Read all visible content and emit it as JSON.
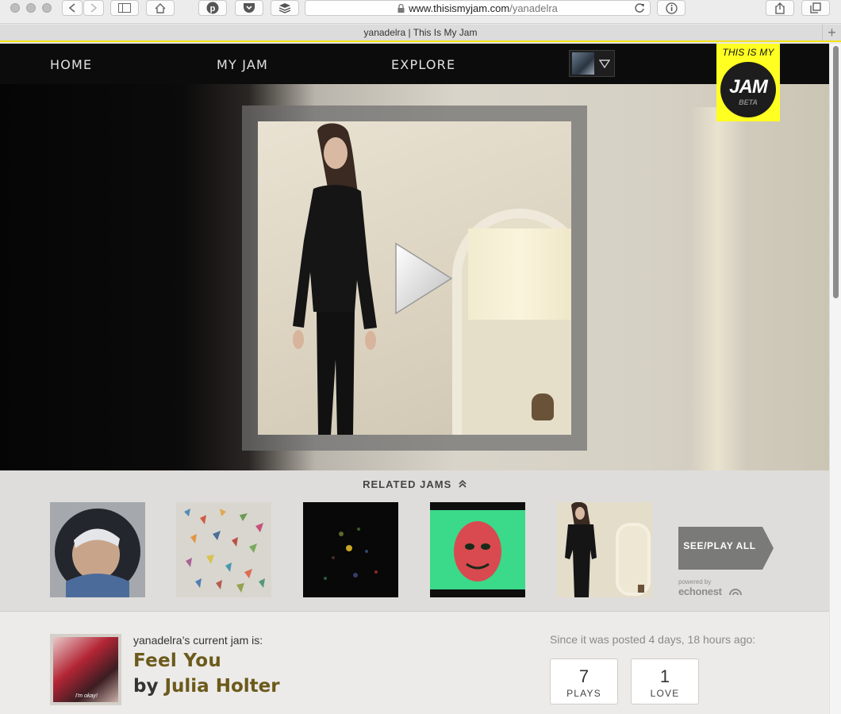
{
  "browser": {
    "url_host": "www.thisismyjam.com",
    "url_path": "/yanadelra",
    "tab_title": "yanadelra | This Is My Jam"
  },
  "nav": {
    "items": [
      "HOME",
      "MY JAM",
      "EXPLORE"
    ]
  },
  "logo": {
    "top": "THIS IS MY",
    "main": "JAM",
    "badge": "BETA"
  },
  "related": {
    "title": "RELATED JAMS",
    "see_all": "SEE/PLAY ALL",
    "powered_by": "powered by",
    "provider": "echonest"
  },
  "current": {
    "label": "yanadelra’s current jam is:",
    "title": "Feel You",
    "by": "by",
    "artist": "Julia Holter",
    "thumb_caption": "I'm okay!",
    "since": "Since it was posted 4 days, 18 hours ago:",
    "plays_count": "7",
    "plays_label": "PLAYS",
    "loves_count": "1",
    "loves_label": "LOVE"
  },
  "colors": {
    "accent_yellow": "#ffff22",
    "song_gold": "#6b5a1b",
    "nav_bg": "#0c0c0c"
  }
}
